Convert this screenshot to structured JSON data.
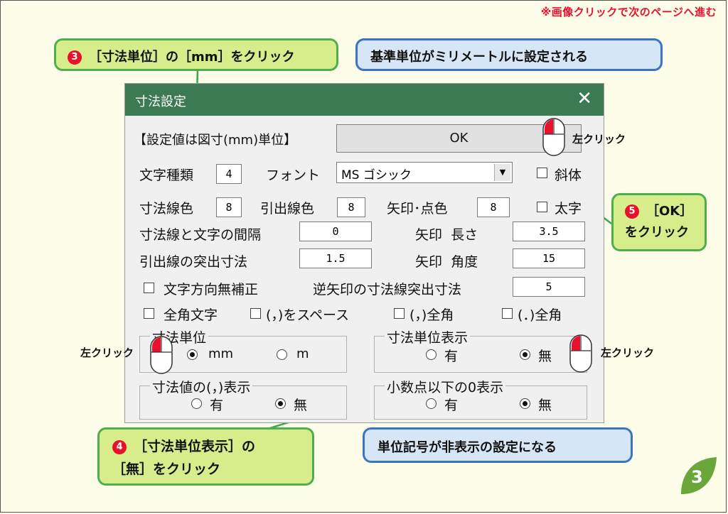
{
  "hint": "※画像クリックで次のページへ進む",
  "callouts": {
    "step3": {
      "num": "3",
      "text": "［寸法単位］の［mm］をクリック"
    },
    "note1": "基準単位がミリメートルに設定される",
    "step5": {
      "num": "5",
      "line1": "［OK］",
      "line2": "をクリック"
    },
    "step4": {
      "num": "4",
      "line1": "［寸法単位表示］の",
      "line2": "［無］をクリック"
    },
    "note2": "単位記号が非表示の設定になる"
  },
  "mouse_labels": {
    "ok": "左クリック",
    "mm": "左クリック",
    "nashi": "左クリック"
  },
  "page_number": "3",
  "dialog": {
    "title": "寸法設定",
    "close": "✕",
    "header_label": "【設定値は図寸(mm)単位】",
    "ok_label": "OK",
    "char_type_label": "文字種類",
    "char_type_value": "4",
    "font_label": "フォント",
    "font_value": "MS ゴシック",
    "italic_label": "斜体",
    "dim_color_label": "寸法線色",
    "dim_color_value": "8",
    "leader_color_label": "引出線色",
    "leader_color_value": "8",
    "arrow_color_label": "矢印･点色",
    "arrow_color_value": "8",
    "bold_label": "太字",
    "gap_label": "寸法線と文字の間隔",
    "gap_value": "0",
    "arrow_len_label": "矢印  長さ",
    "arrow_len_value": "3.5",
    "leader_proj_label": "引出線の突出寸法",
    "leader_proj_value": "1.5",
    "arrow_angle_label": "矢印  角度",
    "arrow_angle_value": "15",
    "no_dir_fix_label": "文字方向無補正",
    "rev_arrow_label": "逆矢印の寸法線突出寸法",
    "rev_arrow_value": "5",
    "fullwidth_label": "全角文字",
    "comma_space_label": "(，)をスペース",
    "comma_full_label": "(，)全角",
    "period_full_label": "(．)全角",
    "unit_group": {
      "title": "寸法単位",
      "opt1": "mm",
      "opt2": "m"
    },
    "unit_display_group": {
      "title": "寸法単位表示",
      "opt1": "有",
      "opt2": "無"
    },
    "comma_display_group": {
      "title": "寸法値の(，)表示",
      "opt1": "有",
      "opt2": "無"
    },
    "zero_display_group": {
      "title": "小数点以下の0表示",
      "opt1": "有",
      "opt2": "無"
    }
  },
  "colors": {
    "titlebar": "#3b7a52",
    "callout_green": "#d7ed8c",
    "callout_blue": "#d7e6f6",
    "accent_red": "#e8112d",
    "leader_line": "#3aa64a"
  }
}
